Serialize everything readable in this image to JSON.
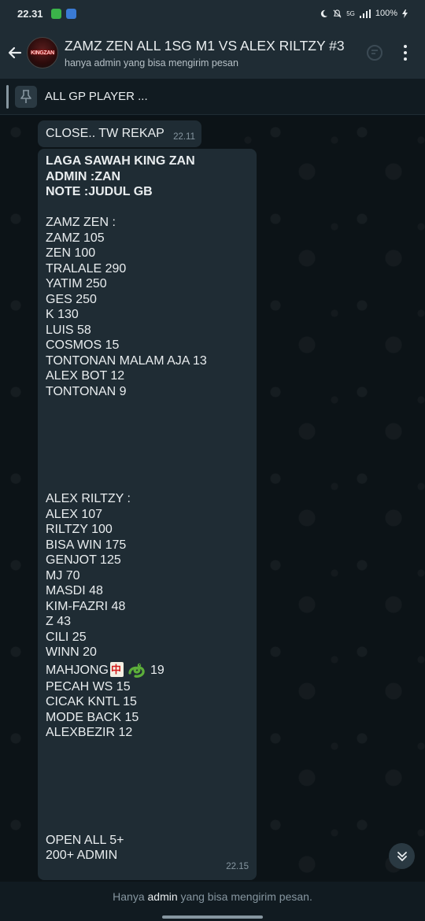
{
  "status_bar": {
    "time": "22.31",
    "battery": "100%",
    "network": "5G"
  },
  "header": {
    "avatar_text": "KINGZAN",
    "title": "ZAMZ ZEN ALL 1SG M1 VS ALEX RILTZY #3",
    "subtitle": "hanya admin yang bisa mengirim pesan"
  },
  "pinned": {
    "text": "ALL GP PLAYER ..."
  },
  "messages": {
    "first": {
      "text": "CLOSE.. TW REKAP",
      "time": "22.11"
    },
    "rekap": {
      "header_lines": [
        "LAGA SAWAH KING ZAN",
        "ADMIN :ZAN",
        "NOTE :JUDUL GB"
      ],
      "team1_title": "ZAMZ ZEN :",
      "team1": [
        "ZAMZ 105",
        "ZEN 100",
        "TRALALE 290",
        "YATIM 250",
        "GES 250",
        "K 130",
        "LUIS 58",
        "COSMOS 15",
        "TONTONAN MALAM AJA 13",
        "ALEX BOT 12",
        "TONTONAN 9"
      ],
      "team2_title": "ALEX RILTZY :",
      "team2": [
        "ALEX 107",
        "RILTZY 100",
        "BISA WIN 175",
        "GENJOT 125",
        "MJ 70",
        "MASDI 48",
        "KIM-FAZRI 48",
        "Z 43",
        "CILI 25",
        "WINN 20"
      ],
      "mahjong_prefix": "MAHJONG",
      "mahjong_value": "19",
      "team2_rest": [
        "PECAH WS 15",
        "CICAK KNTL 15",
        "MODE BACK 15",
        "ALEXBEZIR 12"
      ],
      "footer_lines": [
        "OPEN ALL 5+",
        "200+ ADMIN"
      ],
      "time": "22.15"
    }
  },
  "footer": {
    "prefix": "Hanya",
    "admin": "admin",
    "suffix": "yang bisa mengirim pesan."
  },
  "colors": {
    "background": "#0b141a",
    "bar": "#1f2c34",
    "bubble": "#1f2c34",
    "muted_text": "#8696a0"
  }
}
